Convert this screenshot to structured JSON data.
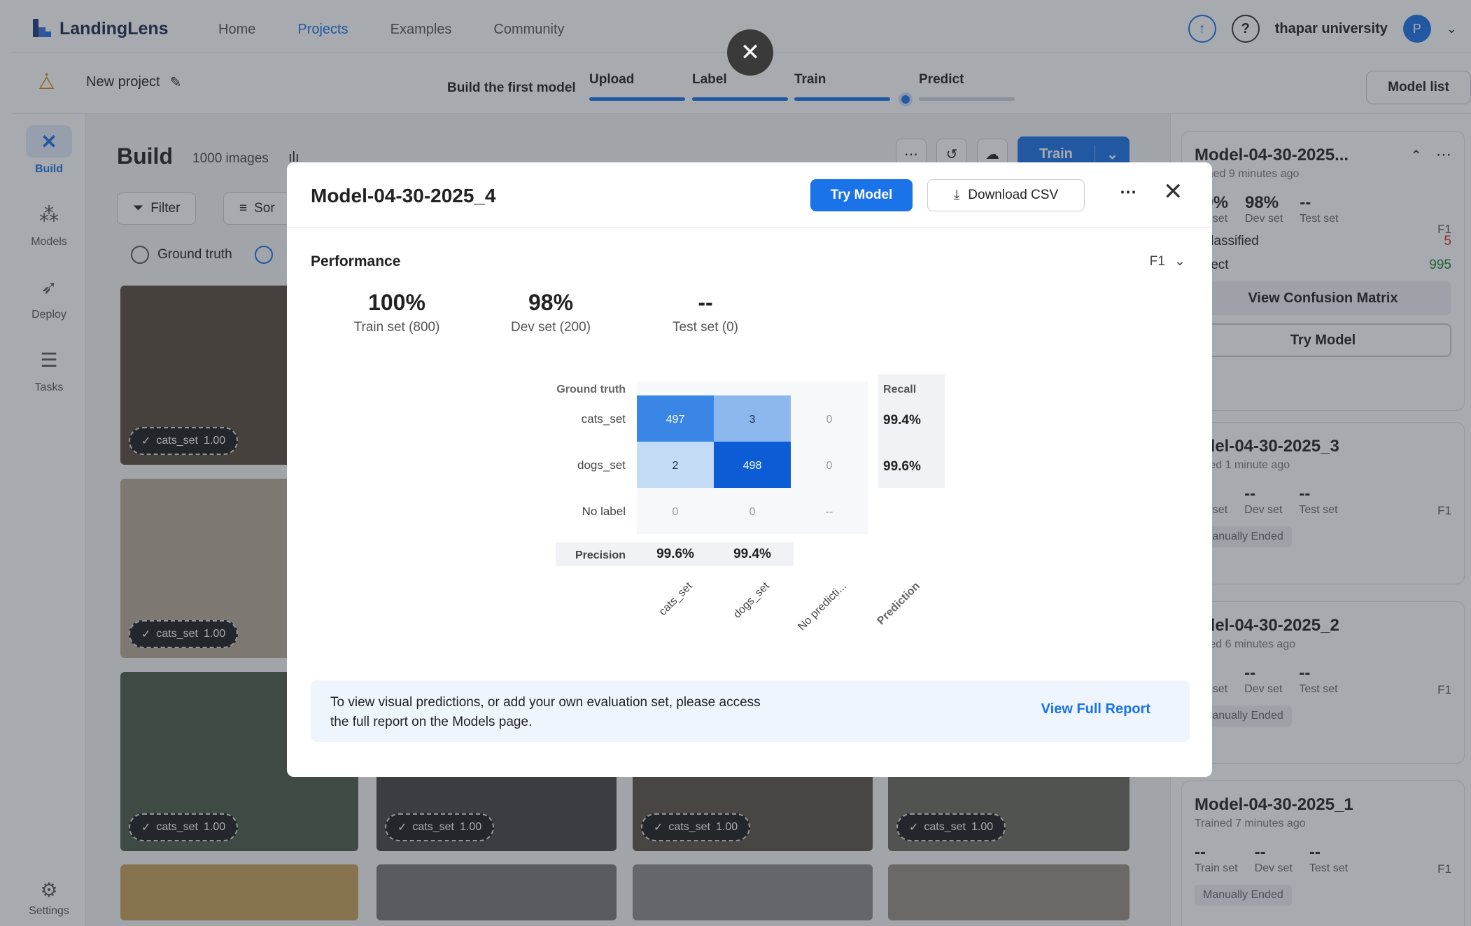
{
  "app": {
    "logo_text": "LandingLens",
    "brand_color": "#1a73e8"
  },
  "nav": {
    "links": [
      "Home",
      "Projects",
      "Examples",
      "Community"
    ],
    "active": "Projects"
  },
  "user": {
    "name": "thapar university",
    "avatar_initial": "P",
    "help_icon": "?"
  },
  "project": {
    "name": "New project",
    "steps_title": "Build the first model",
    "steps": [
      "Upload",
      "Label",
      "Train",
      "Predict"
    ],
    "model_list_label": "Model list"
  },
  "sidebar": {
    "items": [
      {
        "label": "Build",
        "icon": "build-icon"
      },
      {
        "label": "Models",
        "icon": "models-icon"
      },
      {
        "label": "Deploy",
        "icon": "deploy-icon"
      },
      {
        "label": "Tasks",
        "icon": "tasks-icon"
      },
      {
        "label": "Settings",
        "icon": "gear-icon"
      }
    ]
  },
  "build": {
    "title": "Build",
    "count": "1000 images",
    "filter_label": "Filter",
    "sort_label": "Sor",
    "ground_truth_label": "Ground truth",
    "train_label": "Train",
    "tag_label": "cats_set",
    "tag_score": "1.00"
  },
  "right_panel": {
    "models": [
      {
        "name": "Model-04-30-2025...",
        "sub": "rained 9 minutes ago",
        "train": "00%",
        "dev": "98%",
        "test": "--",
        "train_label": "ain set",
        "dev_label": "Dev set",
        "test_label": "Test set",
        "f1": "F1",
        "misclassified_label": "isclassified",
        "misclassified": "5",
        "correct_label": "orrect",
        "correct": "995",
        "confusion_btn": "View Confusion Matrix",
        "try_btn": "Try Model"
      },
      {
        "name": "odel-04-30-2025_3",
        "sub": "ained 1 minute ago",
        "train": "--",
        "dev": "--",
        "test": "--",
        "train_label": "ain set",
        "dev_label": "Dev set",
        "test_label": "Test set",
        "f1": "F1",
        "status": "Manually Ended"
      },
      {
        "name": "odel-04-30-2025_2",
        "sub": "ained 6 minutes ago",
        "train": "--",
        "dev": "--",
        "test": "--",
        "train_label": "ain set",
        "dev_label": "Dev set",
        "test_label": "Test set",
        "f1": "F1",
        "status": "Manually Ended"
      },
      {
        "name": "Model-04-30-2025_1",
        "sub": "Trained 7 minutes ago",
        "train": "--",
        "dev": "--",
        "test": "--",
        "train_label": "Train set",
        "dev_label": "Dev set",
        "test_label": "Test set",
        "f1": "F1",
        "status": "Manually Ended"
      }
    ]
  },
  "modal": {
    "title": "Model-04-30-2025_4",
    "try_label": "Try Model",
    "download_label": "Download CSV",
    "performance_label": "Performance",
    "metric_select": "F1",
    "stats": [
      {
        "value": "100%",
        "label": "Train set (800)"
      },
      {
        "value": "98%",
        "label": "Dev set (200)"
      },
      {
        "value": "--",
        "label": "Test set (0)"
      }
    ],
    "info_text_1": "To view visual predictions, or add your own evaluation set, please access",
    "info_text_2": "the full report on the Models page.",
    "report_link": "View Full Report"
  },
  "chart_data": {
    "type": "heatmap",
    "ylabel": "Ground truth",
    "xlabel": "Prediction",
    "rows": [
      "cats_set",
      "dogs_set",
      "No label"
    ],
    "cols": [
      "cats_set",
      "dogs_set",
      "No predicti..."
    ],
    "values": [
      [
        "497",
        "3",
        "0"
      ],
      [
        "2",
        "498",
        "0"
      ],
      [
        "0",
        "0",
        "--"
      ]
    ],
    "recall_label": "Recall",
    "recall": [
      "99.4%",
      "99.6%"
    ],
    "precision_label": "Precision",
    "precision": [
      "99.6%",
      "99.4%"
    ]
  }
}
